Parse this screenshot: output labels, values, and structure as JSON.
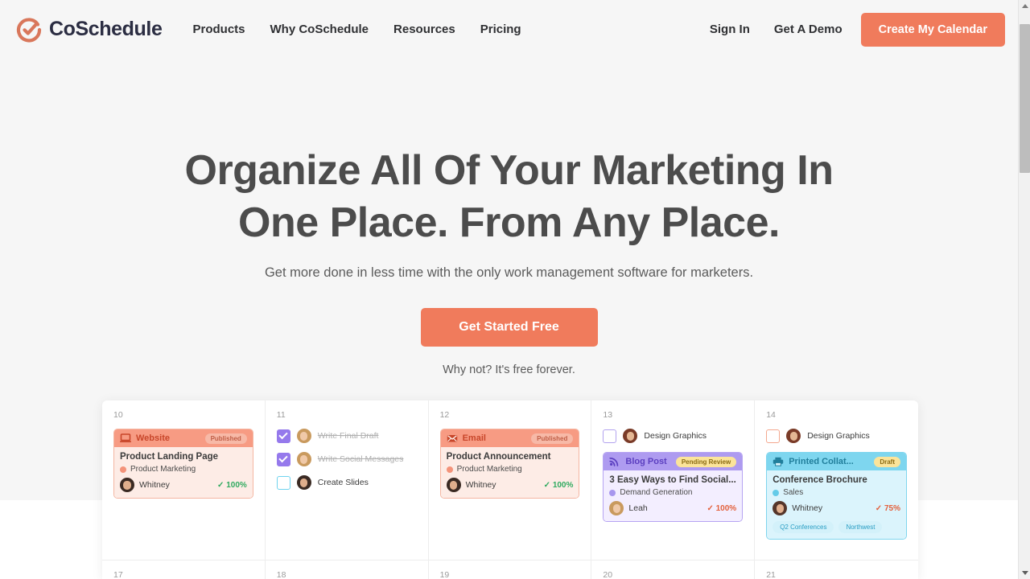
{
  "header": {
    "logo_text": "CoSchedule",
    "logo_icon": "check-circle-logo-icon",
    "nav": [
      {
        "label": "Products"
      },
      {
        "label": "Why CoSchedule"
      },
      {
        "label": "Resources"
      },
      {
        "label": "Pricing"
      }
    ],
    "sign_in": "Sign In",
    "get_demo": "Get A Demo",
    "create_calendar": "Create My Calendar",
    "accent_color": "#f07b5c"
  },
  "hero": {
    "heading_line1": "Organize All Of Your Marketing In",
    "heading_line2": "One Place. From Any Place.",
    "subheading": "Get more done in less time with the only work management software for marketers.",
    "cta_label": "Get Started Free",
    "cta_note": "Why not? It's free forever."
  },
  "calendar": {
    "row1": [
      {
        "day": "10",
        "tasks": [],
        "card": {
          "type_label": "Website",
          "type_icon": "laptop-icon",
          "status": "Published",
          "title": "Product Landing Page",
          "category": "Product Marketing",
          "owner": "Whitney",
          "progress": "100%",
          "theme": "orange",
          "progress_color": "#2faa5f",
          "dot_color": "#f4937a",
          "tags": []
        }
      },
      {
        "day": "11",
        "tasks": [
          {
            "label": "Write Final Draft",
            "state": "checked",
            "avatar": "blonde"
          },
          {
            "label": "Write Social Messages",
            "state": "checked",
            "avatar": "blonde"
          },
          {
            "label": "Create Slides",
            "state": "open-teal",
            "avatar": "dark"
          }
        ],
        "card": null
      },
      {
        "day": "12",
        "tasks": [],
        "card": {
          "type_label": "Email",
          "type_icon": "envelope-icon",
          "status": "Published",
          "title": "Product Announcement",
          "category": "Product Marketing",
          "owner": "Whitney",
          "progress": "100%",
          "theme": "orange",
          "progress_color": "#2faa5f",
          "dot_color": "#f4937a",
          "tags": []
        }
      },
      {
        "day": "13",
        "tasks": [
          {
            "label": "Design Graphics",
            "state": "open-purple",
            "avatar": "red"
          }
        ],
        "card": {
          "type_label": "Blog Post",
          "type_icon": "rss-icon",
          "status": "Pending Review",
          "title": "3 Easy Ways to Find Social...",
          "category": "Demand Generation",
          "owner": "Leah",
          "progress": "100%",
          "theme": "purple",
          "progress_color": "#e3603c",
          "dot_color": "#a796ee",
          "tags": []
        }
      },
      {
        "day": "14",
        "tasks": [
          {
            "label": "Design Graphics",
            "state": "open-orange",
            "avatar": "red"
          }
        ],
        "card": {
          "type_label": "Printed Collat...",
          "type_icon": "printer-icon",
          "status": "Draft",
          "title": "Conference Brochure",
          "category": "Sales",
          "owner": "Whitney",
          "progress": "75%",
          "theme": "blue",
          "progress_color": "#e3603c",
          "dot_color": "#63cbe8",
          "tags": [
            "Q2 Conferences",
            "Northwest"
          ]
        }
      }
    ],
    "row2_days": [
      "17",
      "18",
      "19",
      "20",
      "21"
    ]
  },
  "scrollbar": {
    "up_arrow_icon": "triangle-up-icon",
    "down_arrow_icon": "triangle-down-icon"
  }
}
